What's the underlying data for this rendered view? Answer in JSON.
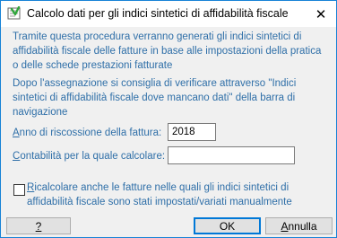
{
  "window": {
    "title": "Calcolo dati per gli indici sintetici di affidabilità fiscale",
    "close_glyph": "✕",
    "icon": "app-icon"
  },
  "info": {
    "paragraph1": "Tramite questa procedura verranno generati gli indici sintetici di affidabilità fiscale delle fatture in base alle impostazioni della pratica o delle schede prestazioni fatturate",
    "paragraph2": "Dopo l'assegnazione si consiglia di verificare attraverso \"Indici sintetici di affidabilità fiscale dove mancano dati\" della barra di navigazione"
  },
  "form": {
    "anno_label_first": "A",
    "anno_label_rest": "nno di riscossione della fattura:",
    "anno_value": "2018",
    "contabilita_label_first": "C",
    "contabilita_label_rest": "ontabilità per la quale calcolare:",
    "contabilita_value": "",
    "checkbox_label_first": "R",
    "checkbox_label_rest": "icalcolare anche le fatture nelle quali gli indici sintetici di affidabilità fiscale sono stati impostati/variati manualmente",
    "checkbox_checked": false
  },
  "buttons": {
    "help": "?",
    "ok": "OK",
    "cancel_first": "A",
    "cancel_rest": "nnulla"
  },
  "colors": {
    "info_text": "#2f6fa8",
    "window_border": "#1883d7",
    "default_button_border": "#0078d7"
  }
}
